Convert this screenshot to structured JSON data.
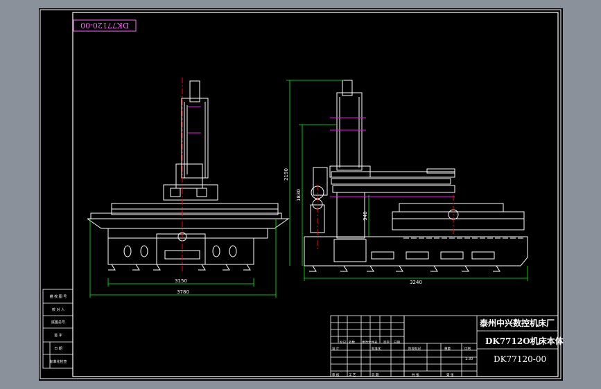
{
  "drawing": {
    "stamp": "DK77120-00",
    "company": "泰州中兴数控机床厂",
    "title": "DK7712O机床本体",
    "drawing_number": "DK77120-00"
  },
  "dimensions": {
    "front_width_inner": "3150",
    "front_width_outer": "3780",
    "side_height_total": "2190",
    "side_height_mid": "1830",
    "side_height_low": "940",
    "side_width": "3240"
  },
  "side_table_rows": [
    "描 校 图 号",
    "校 对 人",
    "底图总号",
    "签 字",
    "日 期",
    "标准化检查"
  ],
  "title_block": {
    "scale": "1:30",
    "labels_row1": [
      "标记",
      "处数",
      "更改文件号",
      "签字",
      "日期"
    ],
    "labels_row2": [
      "设 计",
      "标准化"
    ],
    "labels_row3": [
      "审 核",
      "工 艺",
      "日 期"
    ],
    "labels_row4": [
      "阶段标记",
      "重量",
      "比例"
    ],
    "labels_row5": [
      "共 张",
      "第 张"
    ]
  },
  "colors": {
    "line": "#ffffff",
    "center": "#ff0000",
    "dimension": "#00ff00",
    "accent": "#ff00ff",
    "stamp": "#ff66ff",
    "frame": "#ffffff"
  }
}
